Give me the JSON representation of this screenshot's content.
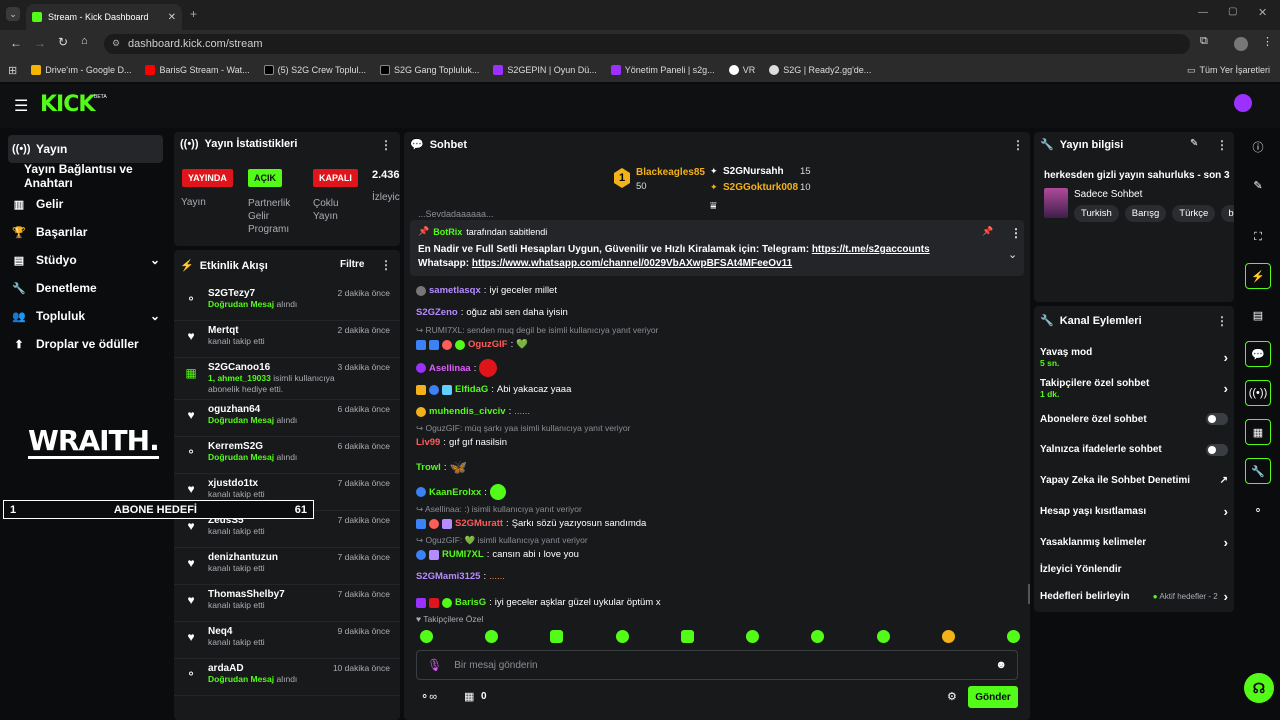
{
  "browser": {
    "tab_title": "Stream - Kick Dashboard",
    "url": "dashboard.kick.com/stream",
    "bookmarks": [
      "Drive'ım - Google D...",
      "BarisG Stream - Wat...",
      "(5) S2G Crew Toplul...",
      "S2G Gang Topluluk...",
      "S2GEPIN | Oyun Dü...",
      "Yönetim Paneli | s2g...",
      "VR",
      "S2G | Ready2.gg'de..."
    ],
    "all_bookmarks": "Tüm Yer İşaretleri"
  },
  "header": {
    "logo": "KICK",
    "beta": "BETA"
  },
  "sidebar": {
    "items": [
      {
        "icon": "((•))",
        "label": "Yayın"
      },
      {
        "icon": "",
        "label": "Yayın Bağlantısı ve Anahtarı"
      },
      {
        "icon": "▥",
        "label": "Gelir"
      },
      {
        "icon": "🏆",
        "label": "Başarılar"
      },
      {
        "icon": "▤",
        "label": "Stüdyo"
      },
      {
        "icon": "🔧",
        "label": "Denetleme"
      },
      {
        "icon": "👥",
        "label": "Topluluk"
      },
      {
        "icon": "⬆",
        "label": "Droplar ve ödüller"
      }
    ],
    "overlay_logo": "WRAITH.",
    "goal": {
      "num": "1",
      "label": "ABONE HEDEFİ",
      "target": "61"
    }
  },
  "stats": {
    "title": "Yayın İstatistikleri",
    "badges": [
      {
        "text": "YAYINDA",
        "sub": "Yayın"
      },
      {
        "text": "AÇIK",
        "sub": "Partnerlik Gelir Programı"
      },
      {
        "text": "KAPALI",
        "sub": "Çoklu Yayın"
      }
    ],
    "viewers": "2.436",
    "viewers_label": "İzleyic"
  },
  "activity": {
    "title": "Etkinlik Akışı",
    "filter": "Filtre",
    "items": [
      {
        "icon": "⚬",
        "name": "S2GTezy7",
        "desc": "Doğrudan Mesaj",
        "desc2": "alındı",
        "time": "2 dakika önce"
      },
      {
        "icon": "♥",
        "name": "Mertqt",
        "desc": "",
        "desc2": "kanalı takip etti",
        "time": "2 dakika önce"
      },
      {
        "icon": "▦",
        "name": "S2GCanoo16",
        "desc": "1, ahmet_19033",
        "desc2": "isimli kullanıcıya abonelik hediye etti.",
        "time": "3 dakika önce"
      },
      {
        "icon": "♥",
        "name": "oguzhan64",
        "desc": "Doğrudan Mesaj",
        "desc2": "alındı",
        "time": "6 dakika önce"
      },
      {
        "icon": "⚬",
        "name": "KerremS2G",
        "desc": "Doğrudan Mesaj",
        "desc2": "alındı",
        "time": "6 dakika önce"
      },
      {
        "icon": "♥",
        "name": "xjustdo1tx",
        "desc": "",
        "desc2": "kanalı takip etti",
        "time": "7 dakika önce"
      },
      {
        "icon": "♥",
        "name": "ZeusS5",
        "desc": "",
        "desc2": "kanalı takip etti",
        "time": "7 dakika önce"
      },
      {
        "icon": "♥",
        "name": "denizhantuzun",
        "desc": "",
        "desc2": "kanalı takip etti",
        "time": "7 dakika önce"
      },
      {
        "icon": "♥",
        "name": "ThomasShelby7",
        "desc": "",
        "desc2": "kanalı takip etti",
        "time": "7 dakika önce"
      },
      {
        "icon": "♥",
        "name": "Neq4",
        "desc": "",
        "desc2": "kanalı takip etti",
        "time": "9 dakika önce"
      },
      {
        "icon": "⚬",
        "name": "ardaAD",
        "desc": "Doğrudan Mesaj",
        "desc2": "alındı",
        "time": "10 dakika önce"
      }
    ]
  },
  "chat": {
    "title": "Sohbet",
    "leaders": [
      {
        "name": "Blackeagles85",
        "count": "50",
        "rank": "1",
        "color": "#f3b21a"
      },
      {
        "name": "S2GNursahh",
        "count": "15",
        "color": "#ffffff"
      },
      {
        "name": "S2GGokturk008",
        "count": "10",
        "color": "#f3b21a"
      }
    ],
    "pinned": {
      "by": "BotRix",
      "by_suffix": "tarafından sabitlendi",
      "text": "En Nadir ve Full Setli Hesapları Uygun, Güvenilir ve Hızlı Kiralamak için: Telegram:",
      "link1": "https://t.me/s2gaccounts",
      "mid": "Whatsapp:",
      "link2": "https://www.whatsapp.com/channel/0029VbAXwpBFSAt4MFeeOv11"
    },
    "partial_top": "...Sevdadaaaaaa...",
    "messages": [
      {
        "user": "sametlasqx",
        "color": "#b58cff",
        "text": "iyi geceler millet"
      },
      {
        "user": "S2GZeno",
        "color": "#b58cff",
        "text": "oğuz abi sen daha iyisin"
      },
      {
        "reply": "RUMI7XL: senden muq degil be isimli kullanıcıya yanıt veriyor"
      },
      {
        "user": "OguzGIF",
        "color": "#ff5c5c",
        "text": "💚"
      },
      {
        "user": "Asellinaa",
        "color": "#e05cff",
        "text": ""
      },
      {
        "user": "ElfidaG",
        "color": "#53fc18",
        "text": "Abi yakacaz yaaa"
      },
      {
        "user": "muhendis_civciv",
        "color": "#53fc18",
        "text": "......"
      },
      {
        "reply": "OguzGIF: müq şarkı yaa isimli kullanıcıya yanıt veriyor"
      },
      {
        "user": "Liv99",
        "color": "#ff5c5c",
        "text": "gıf gıf nasilsin"
      },
      {
        "user": "Trowl",
        "color": "#53fc18",
        "text": "🦋"
      },
      {
        "user": "KaanErolxx",
        "color": "#53fc18",
        "text": ""
      },
      {
        "reply": "Asellinaa: :) isimli kullanıcıya yanıt veriyor"
      },
      {
        "user": "S2GMuratt",
        "color": "#ff5c5c",
        "text": "Şarkı sözü yazıyosun sandımda"
      },
      {
        "reply": "OguzGIF: 💚 isimli kullanıcıya yanıt veriyor"
      },
      {
        "user": "RUMI7XL",
        "color": "#53fc18",
        "text": "cansın abi ı love you"
      },
      {
        "user": "S2GMami3125",
        "color": "#b58cff",
        "text": "......"
      },
      {
        "user": "BarisG",
        "color": "#53fc18",
        "text": "iyi geceler aşklar güzel uykular öptüm x"
      }
    ],
    "followers_only": "Takipçilere Özel",
    "input_placeholder": "Bir mesaj gönderin",
    "bits": "0",
    "send": "Gönder"
  },
  "info": {
    "title": "Yayın bilgisi",
    "stream_title": "herkesden gizli yayın sahurluks - son 3",
    "category": "Sadece Sohbet",
    "tags": [
      "Turkish",
      "Barışg",
      "Türkçe",
      "ba"
    ]
  },
  "channel_actions": {
    "title": "Kanal Eylemleri",
    "items": [
      {
        "label": "Yavaş mod",
        "sub": "5 sn.",
        "ctrl": "chev"
      },
      {
        "label": "Takipçilere özel sohbet",
        "sub": "1 dk.",
        "ctrl": "chev"
      },
      {
        "label": "Abonelere özel sohbet",
        "sub": "",
        "ctrl": "toggle"
      },
      {
        "label": "Yalnızca ifadelerle sohbet",
        "sub": "",
        "ctrl": "toggle"
      },
      {
        "label": "Yapay Zeka ile Sohbet Denetimi",
        "sub": "",
        "ctrl": "ext"
      },
      {
        "label": "Hesap yaşı kısıtlaması",
        "sub": "",
        "ctrl": "chev"
      },
      {
        "label": "Yasaklanmış kelimeler",
        "sub": "",
        "ctrl": "chev"
      },
      {
        "label": "İzleyici Yönlendir",
        "sub": "",
        "ctrl": ""
      },
      {
        "label": "Hedefleri belirleyin",
        "sub": "",
        "ctrl": "chev"
      }
    ],
    "goals_status": "Aktif hedefler - 2"
  },
  "colors": {
    "accent": "#53fc18",
    "live": "#e0151b"
  }
}
